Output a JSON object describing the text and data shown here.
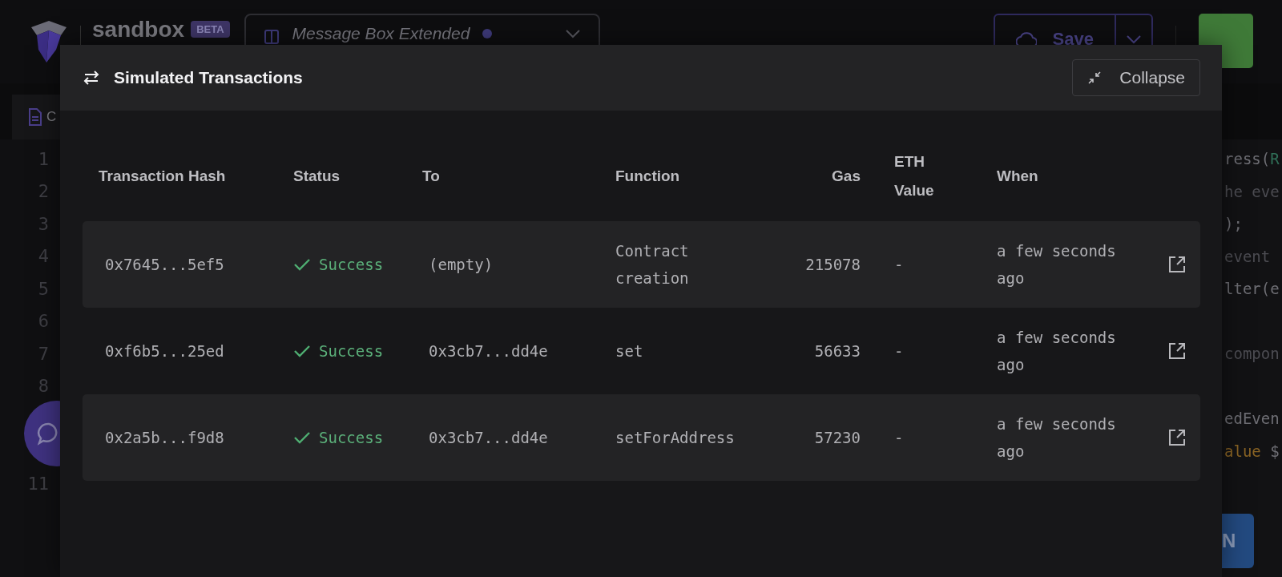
{
  "header": {
    "logo_text": "sandbox",
    "badge": "BETA",
    "project": {
      "name": "Message Box Extended",
      "unsaved": true
    },
    "save_button": "Save"
  },
  "editor": {
    "tab_label": "C",
    "lines": [
      {
        "number": "1",
        "tokens": [
          {
            "text": "ress(",
            "kind": "plain"
          },
          {
            "text": "R",
            "kind": "type"
          }
        ]
      },
      {
        "number": "2",
        "tokens": [
          {
            "text": "he eve",
            "kind": "comment"
          }
        ]
      },
      {
        "number": "3",
        "tokens": [
          {
            "text": ");",
            "kind": "plain"
          }
        ]
      },
      {
        "number": "4",
        "tokens": [
          {
            "text": "event",
            "kind": "comment"
          }
        ]
      },
      {
        "number": "5",
        "tokens": [
          {
            "text": "lter(e",
            "kind": "plain"
          }
        ]
      },
      {
        "number": "6"
      },
      {
        "number": "7",
        "tokens": [
          {
            "text": "compon",
            "kind": "comment"
          }
        ]
      },
      {
        "number": "8"
      },
      {
        "tokens": [
          {
            "text": "edEven",
            "kind": "plain"
          }
        ]
      },
      {
        "tokens": [
          {
            "text": "alue",
            "kind": "literal"
          },
          {
            "text": " $",
            "kind": "plain"
          }
        ]
      },
      {
        "number": "11"
      }
    ],
    "run_button": "N"
  },
  "modal": {
    "title": "Simulated Transactions",
    "collapse_button": "Collapse",
    "table": {
      "columns": [
        "Transaction Hash",
        "Status",
        "To",
        "Function",
        "Gas",
        "ETH Value",
        "When"
      ],
      "rows": [
        {
          "hash": "0x7645...5ef5",
          "status": {
            "kind": "success",
            "label": "Success"
          },
          "to": "(empty)",
          "function": "Contract creation",
          "gas": "215078",
          "eth_value": "-",
          "when": "a few seconds ago"
        },
        {
          "hash": "0xf6b5...25ed",
          "status": {
            "kind": "success",
            "label": "Success"
          },
          "to": "0x3cb7...dd4e",
          "function": "set",
          "gas": "56633",
          "eth_value": "-",
          "when": "a few seconds ago"
        },
        {
          "hash": "0x2a5b...f9d8",
          "status": {
            "kind": "success",
            "label": "Success"
          },
          "to": "0x3cb7...dd4e",
          "function": "setForAddress",
          "gas": "57230",
          "eth_value": "-",
          "when": "a few seconds ago"
        }
      ]
    }
  }
}
